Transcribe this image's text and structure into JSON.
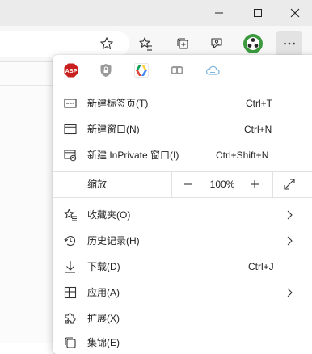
{
  "menu": {
    "extensions": [
      {
        "name": "adblock-plus",
        "label": "ABP",
        "color": "#c7201f"
      },
      {
        "name": "privacy-shield",
        "color": "#8a8a8a"
      },
      {
        "name": "google-drive",
        "color": "#1a73e8"
      },
      {
        "name": "game-controller",
        "color": "#9a9a9a"
      },
      {
        "name": "cloud-sync",
        "color": "#7fb6df"
      }
    ],
    "new_tab": {
      "label": "新建标签页(T)",
      "shortcut": "Ctrl+T"
    },
    "new_window": {
      "label": "新建窗口(N)",
      "shortcut": "Ctrl+N"
    },
    "new_inprivate": {
      "label": "新建 InPrivate 窗口(I)",
      "shortcut": "Ctrl+Shift+N"
    },
    "zoom": {
      "label": "缩放",
      "value": "100%"
    },
    "favorites": {
      "label": "收藏夹(O)"
    },
    "history": {
      "label": "历史记录(H)"
    },
    "downloads": {
      "label": "下载(D)",
      "shortcut": "Ctrl+J"
    },
    "apps": {
      "label": "应用(A)"
    },
    "extensions_item": {
      "label": "扩展(X)"
    },
    "collections": {
      "label": "集锦(E)"
    }
  },
  "colors": {
    "titlebar": "#ebebeb",
    "toolbar": "#f7f7f7",
    "menu_bg": "#ffffff",
    "text": "#1f1f1f",
    "profile_accent": "#3c9a3e"
  }
}
